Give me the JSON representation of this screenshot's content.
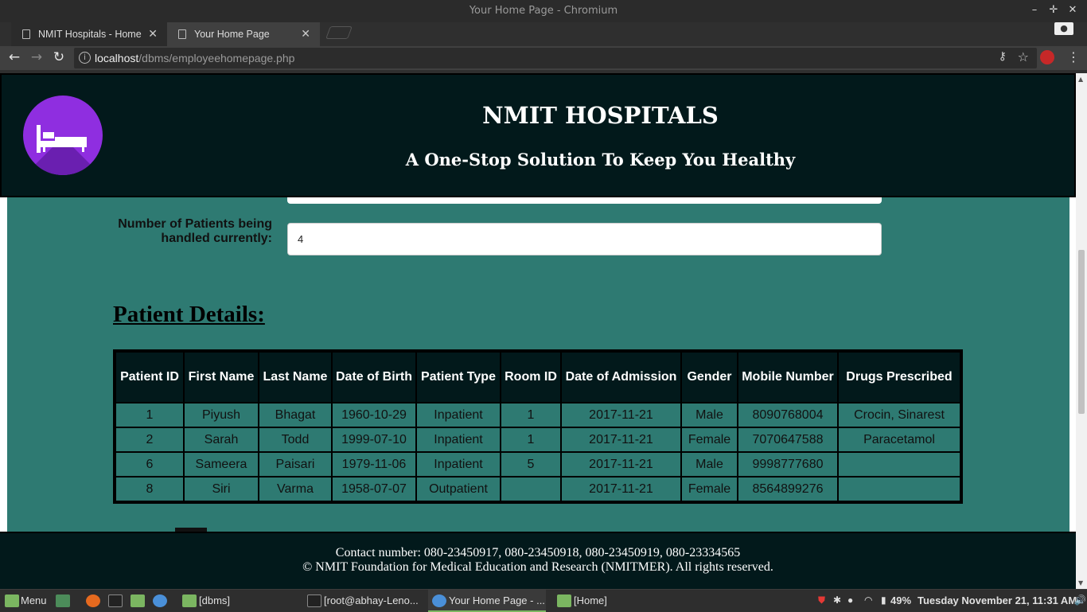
{
  "window": {
    "title": "Your Home Page - Chromium"
  },
  "tabs": [
    {
      "label": "NMIT Hospitals - Home",
      "active": false
    },
    {
      "label": "Your Home Page",
      "active": true
    }
  ],
  "address_bar": {
    "host": "localhost",
    "path": "/dbms/employeehomepage.php"
  },
  "header": {
    "title": "NMIT HOSPITALS",
    "subtitle": "A One-Stop Solution To Keep You Healthy",
    "logo_icon": "bed-icon",
    "logo_color": "#8f2ee0"
  },
  "form": {
    "patients_label": "Number of Patients being handled currently:",
    "patients_value": "4"
  },
  "patients": {
    "section_title": "Patient Details:",
    "columns": [
      "Patient ID",
      "First Name",
      "Last Name",
      "Date of Birth",
      "Patient Type",
      "Room ID",
      "Date of Admission",
      "Gender",
      "Mobile Number",
      "Drugs Prescribed"
    ],
    "rows": [
      [
        "1",
        "Piyush",
        "Bhagat",
        "1960-10-29",
        "Inpatient",
        "1",
        "2017-11-21",
        "Male",
        "8090768004",
        "Crocin, Sinarest"
      ],
      [
        "2",
        "Sarah",
        "Todd",
        "1999-07-10",
        "Inpatient",
        "1",
        "2017-11-21",
        "Female",
        "7070647588",
        "Paracetamol"
      ],
      [
        "6",
        "Sameera",
        "Paisari",
        "1979-11-06",
        "Inpatient",
        "5",
        "2017-11-21",
        "Male",
        "9998777680",
        ""
      ],
      [
        "8",
        "Siri",
        "Varma",
        "1958-07-07",
        "Outpatient",
        "",
        "2017-11-21",
        "Female",
        "8564899276",
        ""
      ]
    ]
  },
  "footer": {
    "contact": "Contact number: 080-23450917, 080-23450918, 080-23450919, 080-23334565",
    "copyright": "© NMIT Foundation for Medical Education and Research (NMITMER). All rights reserved."
  },
  "taskbar": {
    "menu_label": "Menu",
    "items": [
      "[dbms]",
      "[root@abhay-Leno...",
      "Your Home Page - ...",
      "[Home]"
    ],
    "battery": "49%",
    "clock": "Tuesday November 21, 11:31 AM"
  },
  "colors": {
    "page_bg": "#2e7a72",
    "header_bg": "#02191b"
  }
}
